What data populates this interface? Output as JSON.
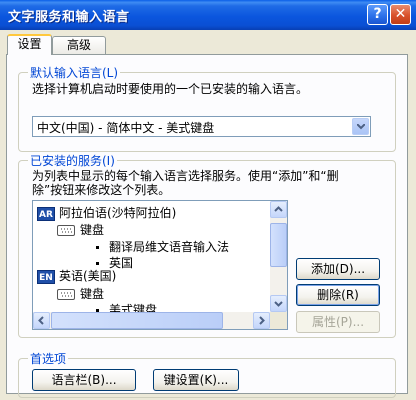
{
  "window": {
    "title": "文字服务和输入语言"
  },
  "titlebar": {
    "help_label": "?",
    "close_label": "✕"
  },
  "tabs": [
    {
      "label": "设置",
      "active": true
    },
    {
      "label": "高级",
      "active": false
    }
  ],
  "default_language": {
    "group_title": "默认输入语言(L)",
    "description": "选择计算机启动时要使用的一个已安装的输入语言。",
    "selected": "中文(中国) - 简体中文 - 美式键盘"
  },
  "installed_services": {
    "group_title": "已安装的服务(I)",
    "description_line1": "为列表中显示的每个输入语言选择服务。使用“添加”和“删",
    "description_line2": "除”按钮来修改这个列表。",
    "tree": [
      {
        "badge": "AR",
        "label": "阿拉伯语(沙特阿拉伯)",
        "level": 0,
        "icon": "language-badge"
      },
      {
        "label": "键盘",
        "level": 1,
        "icon": "keyboard-icon"
      },
      {
        "label": "翻译局维文语音输入法",
        "level": 2,
        "icon": "bullet"
      },
      {
        "label": "英国",
        "level": 2,
        "icon": "bullet"
      },
      {
        "badge": "EN",
        "label": "英语(美国)",
        "level": 0,
        "icon": "language-badge"
      },
      {
        "label": "键盘",
        "level": 1,
        "icon": "keyboard-icon"
      },
      {
        "label": "美式键盘",
        "level": 2,
        "icon": "bullet"
      }
    ],
    "buttons": {
      "add": "添加(D)...",
      "remove": "删除(R)",
      "properties": "属性(P)..."
    }
  },
  "preferences": {
    "group_title": "首选项",
    "language_bar_button": "语言栏(B)...",
    "key_settings_button": "键设置(K)..."
  },
  "colors": {
    "title_bar": "#0A4FD4",
    "group_title": "#0046D5",
    "tab_highlight": "#FFC83C"
  }
}
